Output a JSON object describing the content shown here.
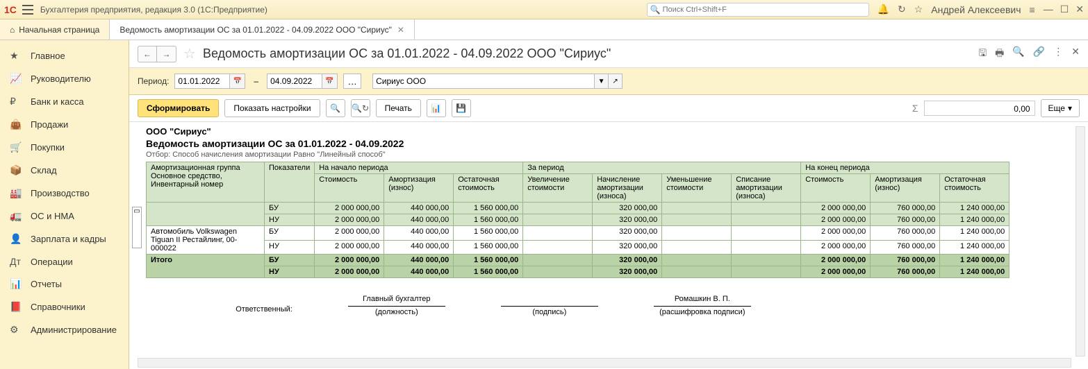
{
  "app": {
    "title": "Бухгалтерия предприятия, редакция 3.0  (1С:Предприятие)",
    "search_placeholder": "Поиск Ctrl+Shift+F",
    "username": "Андрей Алексеевич"
  },
  "tabs": {
    "home": "Начальная страница",
    "report": "Ведомость амортизации ОС за 01.01.2022 - 04.09.2022 ООО \"Сириус\""
  },
  "sidebar": [
    "Главное",
    "Руководителю",
    "Банк и касса",
    "Продажи",
    "Покупки",
    "Склад",
    "Производство",
    "ОС и НМА",
    "Зарплата и кадры",
    "Операции",
    "Отчеты",
    "Справочники",
    "Администрирование"
  ],
  "sidebar_icons": [
    "★",
    "📈",
    "₽",
    "👜",
    "🛒",
    "📦",
    "🏭",
    "🚛",
    "👤",
    "Дт",
    "📊",
    "📕",
    "⚙"
  ],
  "report": {
    "title": "Ведомость амортизации ОС за 01.01.2022 - 04.09.2022 ООО \"Сириус\"",
    "period_label": "Период:",
    "date_from": "01.01.2022",
    "date_to": "04.09.2022",
    "org": "Сириус ООО",
    "form_btn": "Сформировать",
    "settings_btn": "Показать настройки",
    "print_btn": "Печать",
    "more_btn": "Еще",
    "sigma_value": "0,00",
    "org_title": "ООО \"Сириус\"",
    "report_name": "Ведомость амортизации ОС за 01.01.2022 - 04.09.2022",
    "filter_text": "Отбор: Способ начисления амортизации Равно \"Линейный способ\""
  },
  "headers": {
    "c1": "Амортизационная группа",
    "c2": "Показатели",
    "g1": "На начало периода",
    "g2": "За период",
    "g3": "На конец периода",
    "c1b": "Основное средство,\nИнвентарный номер",
    "s1": "Стоимость",
    "s2": "Амортизация (износ)",
    "s3": "Остаточная стоимость",
    "s4": "Увеличение стоимости",
    "s5": "Начисление амортизации (износа)",
    "s6": "Уменьшение стоимости",
    "s7": "Списание амортизации (износа)",
    "s8": "Стоимость",
    "s9": "Амортизация (износ)",
    "s10": "Остаточная стоимость"
  },
  "rows": {
    "asset": "Автомобиль Volkswagen Tiguan II Рестайлинг, 00-000022",
    "bu": "БУ",
    "nu": "НУ",
    "total": "Итого",
    "v_cost": "2 000 000,00",
    "v_dep": "440 000,00",
    "v_res": "1 560 000,00",
    "v_acc": "320 000,00",
    "v_dep2": "760 000,00",
    "v_res2": "1 240 000,00"
  },
  "sig": {
    "resp": "Ответственный:",
    "pos": "Главный бухгалтер",
    "pos_l": "(должность)",
    "sign_l": "(подпись)",
    "name": "Ромашкин В. П.",
    "name_l": "(расшифровка подписи)"
  }
}
